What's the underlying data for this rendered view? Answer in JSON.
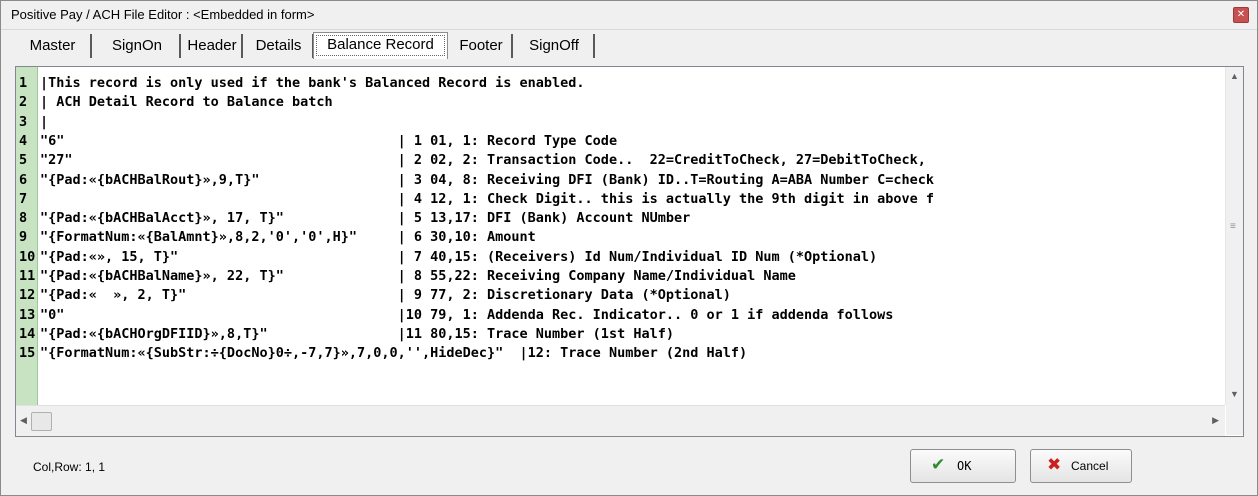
{
  "window": {
    "title": "Positive Pay / ACH File  Editor : <Embedded in form>",
    "close_glyph": "✕"
  },
  "tabs": [
    {
      "label": "Master"
    },
    {
      "label": "SignOn"
    },
    {
      "label": "Header"
    },
    {
      "label": "Details"
    },
    {
      "label": "Balance Record"
    },
    {
      "label": "Footer"
    },
    {
      "label": "SignOff"
    }
  ],
  "editor": {
    "lines": [
      {
        "num": "1",
        "text": "|This record is only used if the bank's Balanced Record is enabled."
      },
      {
        "num": "2",
        "text": "| ACH Detail Record to Balance batch"
      },
      {
        "num": "3",
        "text": "|"
      },
      {
        "num": "4",
        "text": "\"6\"                                         | 1 01, 1: Record Type Code"
      },
      {
        "num": "5",
        "text": "\"27\"                                        | 2 02, 2: Transaction Code..  22=CreditToCheck, 27=DebitToCheck,"
      },
      {
        "num": "6",
        "text": "\"{Pad:«{bACHBalRout}»,9,T}\"                 | 3 04, 8: Receiving DFI (Bank) ID..T=Routing A=ABA Number C=check"
      },
      {
        "num": "7",
        "text": "                                            | 4 12, 1: Check Digit.. this is actually the 9th digit in above f"
      },
      {
        "num": "8",
        "text": "\"{Pad:«{bACHBalAcct}», 17, T}\"              | 5 13,17: DFI (Bank) Account NUmber"
      },
      {
        "num": "9",
        "text": "\"{FormatNum:«{BalAmnt}»,8,2,'0','0',H}\"     | 6 30,10: Amount"
      },
      {
        "num": "10",
        "text": "\"{Pad:«», 15, T}\"                           | 7 40,15: (Receivers) Id Num/Individual ID Num (*Optional)"
      },
      {
        "num": "11",
        "text": "\"{Pad:«{bACHBalName}», 22, T}\"              | 8 55,22: Receiving Company Name/Individual Name"
      },
      {
        "num": "12",
        "text": "\"{Pad:«  », 2, T}\"                          | 9 77, 2: Discretionary Data (*Optional)"
      },
      {
        "num": "13",
        "text": "\"0\"                                         |10 79, 1: Addenda Rec. Indicator.. 0 or 1 if addenda follows"
      },
      {
        "num": "14",
        "text": "\"{Pad:«{bACHOrgDFIID}»,8,T}\"                |11 80,15: Trace Number (1st Half)"
      },
      {
        "num": "15",
        "text": "\"{FormatNum:«{SubStr:÷{DocNo}0÷,-7,7}»,7,0,0,'',HideDec}\"  |12: Trace Number (2nd Half)"
      }
    ]
  },
  "status": {
    "text": "Col,Row: 1, 1"
  },
  "buttons": {
    "ok": {
      "label": "OK",
      "icon": "✔"
    },
    "cancel": {
      "label": "Cancel",
      "icon": "✖"
    }
  },
  "colors": {
    "gutter": "#c7e3c2",
    "ok_icon": "#2e8b2e",
    "cancel_icon": "#cc2020"
  }
}
